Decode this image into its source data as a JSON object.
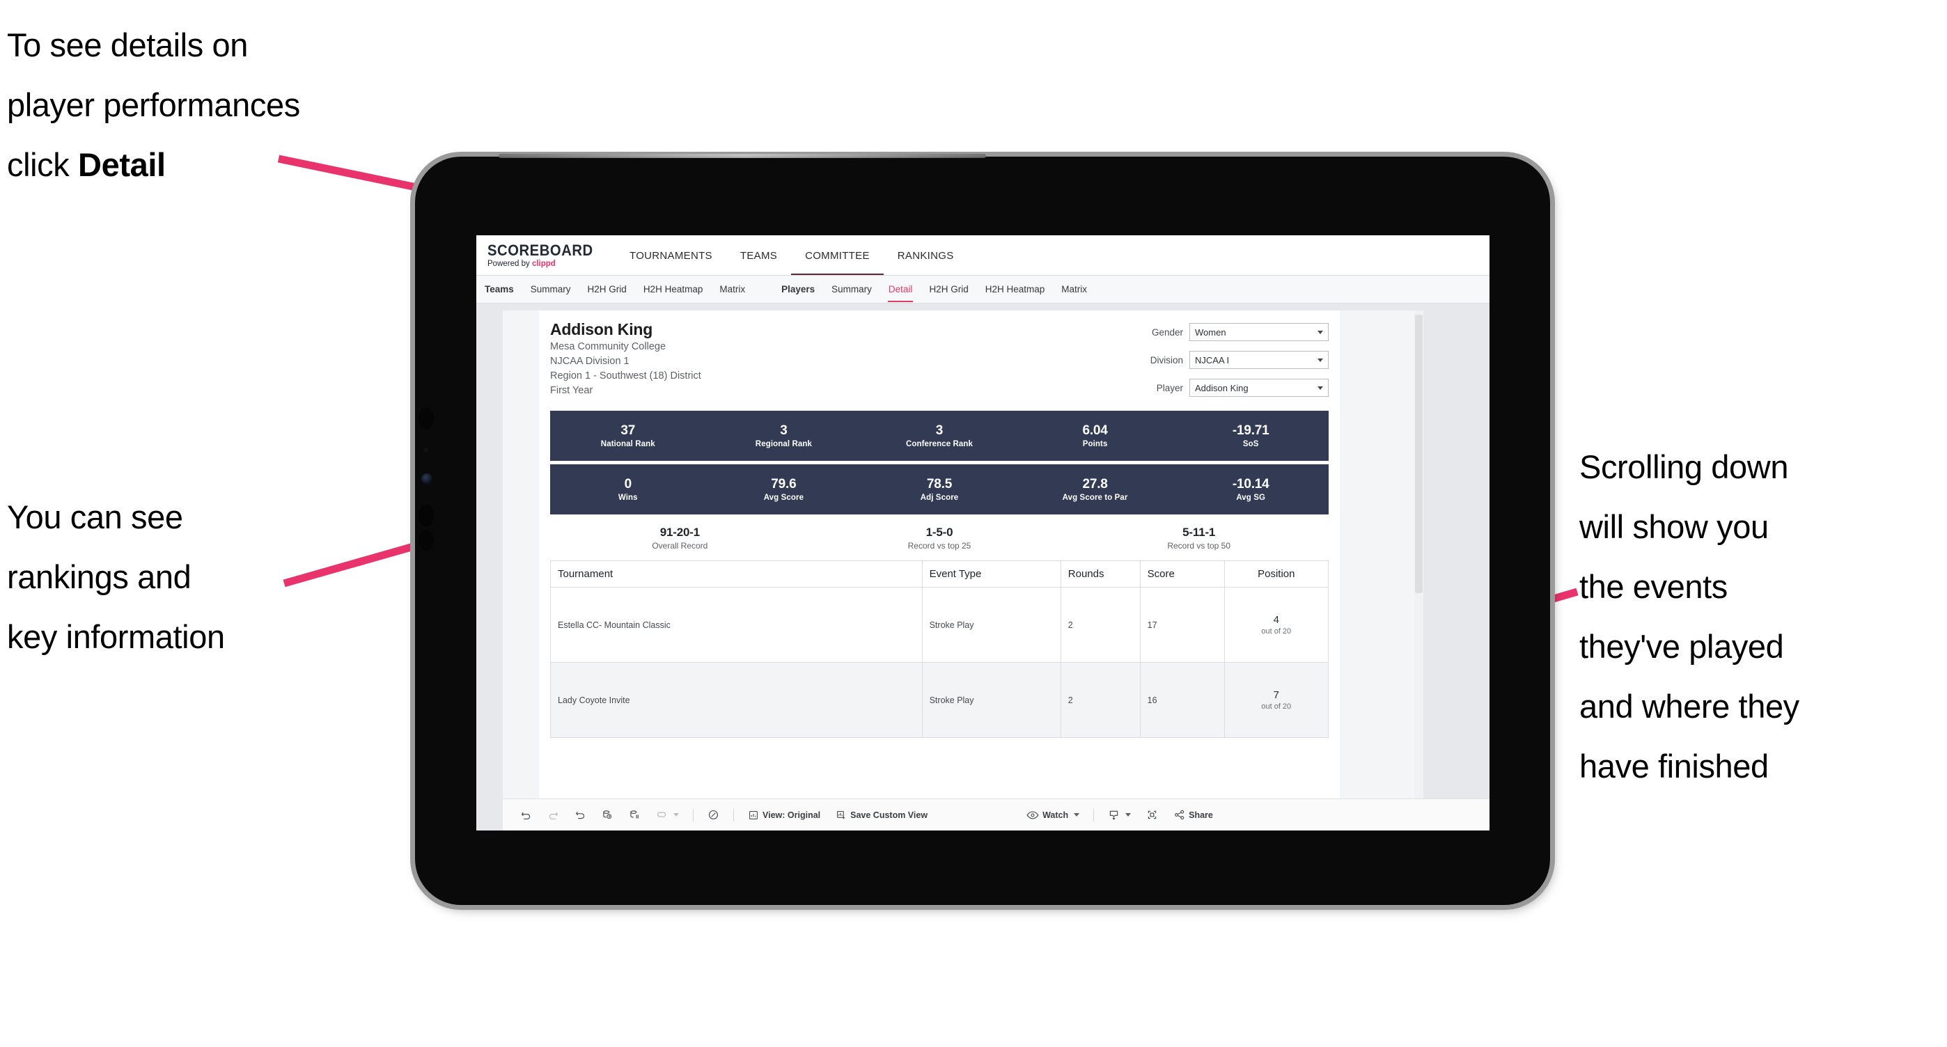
{
  "annotations": {
    "top_left": "To see details on\nplayer performances\nclick ",
    "top_left_bold": "Detail",
    "mid_left": "You can see\nrankings and\nkey information",
    "right": "Scrolling down\nwill show you\nthe events\nthey've played\nand where they\nhave finished",
    "arrow_color": "#e8336d"
  },
  "app": {
    "logo_title": "SCOREBOARD",
    "logo_sub_prefix": "Powered by ",
    "logo_sub_brand": "clippd",
    "top_nav": [
      {
        "label": "TOURNAMENTS"
      },
      {
        "label": "TEAMS"
      },
      {
        "label": "COMMITTEE"
      },
      {
        "label": "RANKINGS"
      }
    ],
    "sub_nav_teams": [
      {
        "label": "Teams"
      },
      {
        "label": "Summary"
      },
      {
        "label": "H2H Grid"
      },
      {
        "label": "H2H Heatmap"
      },
      {
        "label": "Matrix"
      }
    ],
    "sub_nav_players": [
      {
        "label": "Players"
      },
      {
        "label": "Summary"
      },
      {
        "label": "Detail"
      },
      {
        "label": "H2H Grid"
      },
      {
        "label": "H2H Heatmap"
      },
      {
        "label": "Matrix"
      }
    ],
    "active_sub_nav": "Detail",
    "accent_color": "#e23a63",
    "dark_bar_color": "#333b54"
  },
  "player": {
    "name": "Addison King",
    "school": "Mesa Community College",
    "division": "NJCAA Division 1",
    "region": "Region 1 - Southwest (18) District",
    "year": "First Year"
  },
  "filters": [
    {
      "label": "Gender",
      "value": "Women"
    },
    {
      "label": "Division",
      "value": "NJCAA I"
    },
    {
      "label": "Player",
      "value": "Addison King"
    }
  ],
  "stats_row_1": [
    {
      "value": "37",
      "label": "National Rank"
    },
    {
      "value": "3",
      "label": "Regional Rank"
    },
    {
      "value": "3",
      "label": "Conference Rank"
    },
    {
      "value": "6.04",
      "label": "Points"
    },
    {
      "value": "-19.71",
      "label": "SoS"
    }
  ],
  "stats_row_2": [
    {
      "value": "0",
      "label": "Wins"
    },
    {
      "value": "79.6",
      "label": "Avg Score"
    },
    {
      "value": "78.5",
      "label": "Adj Score"
    },
    {
      "value": "27.8",
      "label": "Avg Score to Par"
    },
    {
      "value": "-10.14",
      "label": "Avg SG"
    }
  ],
  "records": [
    {
      "value": "91-20-1",
      "label": "Overall Record"
    },
    {
      "value": "1-5-0",
      "label": "Record vs top 25"
    },
    {
      "value": "5-11-1",
      "label": "Record vs top 50"
    }
  ],
  "events_table": {
    "headers": [
      "Tournament",
      "Event Type",
      "Rounds",
      "Score",
      "Position"
    ],
    "rows": [
      {
        "tournament": "Estella CC- Mountain Classic",
        "event_type": "Stroke Play",
        "rounds": "2",
        "score": "17",
        "position": "4",
        "position_sub": "out of 20"
      },
      {
        "tournament": "Lady Coyote Invite",
        "event_type": "Stroke Play",
        "rounds": "2",
        "score": "16",
        "position": "7",
        "position_sub": "out of 20"
      }
    ]
  },
  "toolbar": {
    "view_label": "View: Original",
    "save_label": "Save Custom View",
    "watch_label": "Watch",
    "share_label": "Share"
  }
}
